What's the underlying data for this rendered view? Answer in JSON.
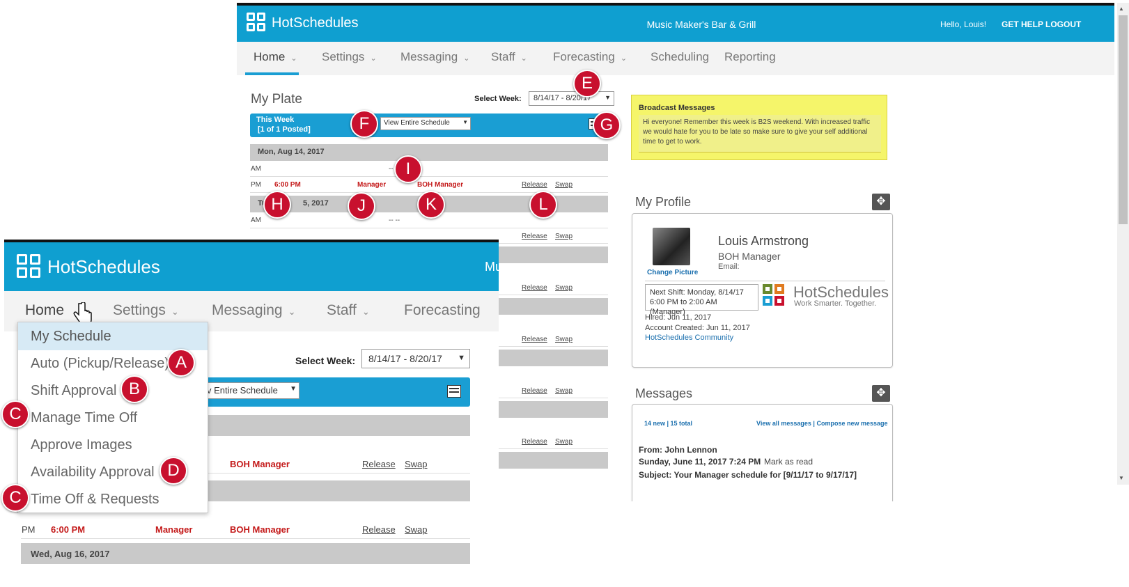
{
  "app": {
    "brand": "HotSchedules",
    "restaurant": "Music Maker's Bar & Grill",
    "greeting": "Hello, Louis!",
    "get_help": "GET HELP",
    "logout": "LOGOUT",
    "accent_color": "#0f9fd0",
    "red_color": "#c41a1a"
  },
  "nav": [
    {
      "label": "Home",
      "has_menu": true,
      "active": true
    },
    {
      "label": "Settings",
      "has_menu": true
    },
    {
      "label": "Messaging",
      "has_menu": true
    },
    {
      "label": "Staff",
      "has_menu": true
    },
    {
      "label": "Forecasting",
      "has_menu": true
    },
    {
      "label": "Scheduling"
    },
    {
      "label": "Reporting"
    }
  ],
  "my_plate": {
    "title": "My Plate",
    "select_week_label": "Select Week:",
    "week_value": "8/14/17 - 8/20/17",
    "this_week_line1": "This Week",
    "this_week_line2": "[1 of 1 Posted]",
    "view_select": "View Entire Schedule",
    "printer_icon": "printer-icon",
    "days": [
      {
        "label": "Mon, Aug 14, 2017",
        "am": {
          "period": "AM",
          "value": "-- --"
        },
        "pm": {
          "period": "PM",
          "time": "6:00 PM",
          "role": "Manager",
          "position": "BOH Manager",
          "release": "Release",
          "swap": "Swap"
        }
      },
      {
        "label": "Tue",
        "label_tail": "5, 2017",
        "am": {
          "period": "AM",
          "value": "-- --"
        }
      }
    ],
    "extra_links": {
      "release": "Release",
      "swap": "Swap"
    }
  },
  "broadcast": {
    "title": "Broadcast Messages",
    "text": "Hi everyone! Remember this week is B2S weekend. With increased traffic we would hate for you to be late so make sure to give your self additional time to get to work."
  },
  "profile": {
    "title": "My Profile",
    "name": "Louis Armstrong",
    "role": "BOH Manager",
    "email_label": "Email:",
    "change_picture": "Change Picture",
    "next_shift_line1": "Next Shift: Monday, 8/14/17",
    "next_shift_line2": "6:00 PM to 2:00 AM (Manager)",
    "hired": "Hired: Jun 11, 2017",
    "account_created": "Account Created: Jun 11, 2017",
    "community_link": "HotSchedules Community",
    "promo_brand": "HotSchedules",
    "promo_tagline": "Work Smarter. Together."
  },
  "messages": {
    "title": "Messages",
    "counts": "14 new | 15 total",
    "view_all": "View all messages",
    "separator": "|",
    "compose": "Compose new message",
    "from": "From: John Lennon",
    "date": "Sunday, June 11, 2017 7:24 PM",
    "mark_read": "Mark as read",
    "subject": "Subject: Your Manager schedule for [9/11/17 to 9/17/17]"
  },
  "zoom": {
    "truncated_restaurant": "Mu",
    "nav": [
      "Home",
      "Settings",
      "Messaging",
      "Staff",
      "Forecasting"
    ],
    "select_week_label": "Select Week:",
    "week_value": "8/14/17 - 8/20/17",
    "view_select_partial": "v Entire Schedule",
    "menu_items": [
      "My Schedule",
      "Auto (Pickup/Release)",
      "Shift Approval",
      "Manage Time Off",
      "Approve Images",
      "Availability Approval",
      "Time Off & Requests"
    ],
    "row1": {
      "position": "BOH Manager",
      "release": "Release",
      "swap": "Swap"
    },
    "row2": {
      "period": "PM",
      "time": "6:00 PM",
      "role": "Manager",
      "position": "BOH Manager",
      "release": "Release",
      "swap": "Swap"
    },
    "partial_period": "AM",
    "day_label": "Wed, Aug 16, 2017"
  },
  "badges": {
    "A": "A",
    "B": "B",
    "C": "C",
    "D": "D",
    "E": "E",
    "F": "F",
    "G": "G",
    "H": "H",
    "I": "I",
    "J": "J",
    "K": "K",
    "L": "L"
  }
}
